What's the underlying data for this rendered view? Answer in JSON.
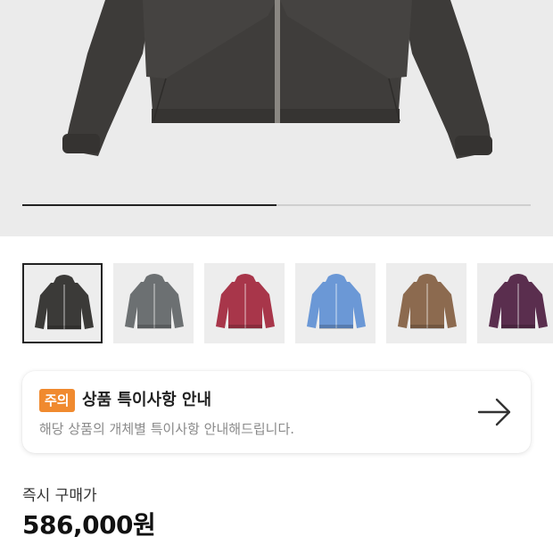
{
  "hero": {
    "image": "dark-gray-hooded-zip-jacket",
    "jacket_color": "#3d3b39",
    "image_progress": 0.5
  },
  "thumbnails": [
    {
      "name": "jacket-charcoal",
      "color": "#3b3a38",
      "selected": true
    },
    {
      "name": "jacket-gray",
      "color": "#6c7072",
      "selected": false
    },
    {
      "name": "jacket-red",
      "color": "#a8364a",
      "selected": false
    },
    {
      "name": "jacket-blue",
      "color": "#6b98d6",
      "selected": false
    },
    {
      "name": "jacket-brown",
      "color": "#8c6a4f",
      "selected": false
    },
    {
      "name": "jacket-purple",
      "color": "#5a2e4e",
      "selected": false
    }
  ],
  "notice": {
    "badge": "주의",
    "title": "상품 특이사항 안내",
    "description": "해당 상품의 개체별 특이사항 안내해드립니다.",
    "badge_color": "#f08a2f",
    "arrow_icon": "arrow-right-icon"
  },
  "price": {
    "label": "즉시 구매가",
    "value": "586,000원"
  }
}
